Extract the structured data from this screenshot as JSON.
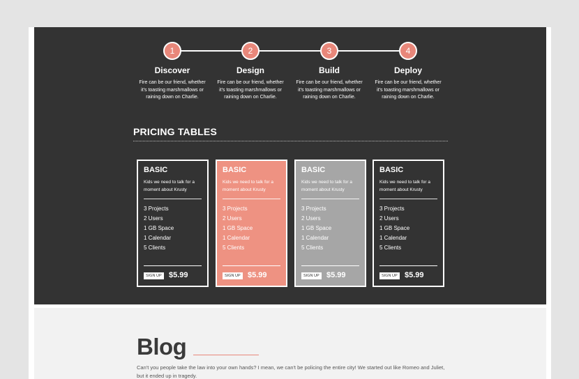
{
  "process": {
    "steps": [
      {
        "number": "1",
        "title": "Discover",
        "desc": "Fire can be our friend, whether it's toasting marshmallows or raining down on Charlie."
      },
      {
        "number": "2",
        "title": "Design",
        "desc": "Fire can be our friend, whether it's toasting marshmallows or raining down on Charlie."
      },
      {
        "number": "3",
        "title": "Build",
        "desc": "Fire can be our friend, whether it's toasting marshmallows or raining down on Charlie."
      },
      {
        "number": "4",
        "title": "Deploy",
        "desc": "Fire can be our friend, whether it's toasting marshmallows or raining down on Charlie."
      }
    ]
  },
  "pricing": {
    "heading": "PRICING TABLES",
    "cards": [
      {
        "title": "BASIC",
        "desc": "Kids we need to talk for a moment about Krusty",
        "features": [
          "3 Projects",
          "2 Users",
          "1 GB Space",
          "1 Calendar",
          "5 Clients"
        ],
        "signup_label": "SIGN UP",
        "price": "$5.99",
        "bg": "#333333"
      },
      {
        "title": "BASIC",
        "desc": "Kids we need to talk for a moment about Krusty",
        "features": [
          "3 Projects",
          "2 Users",
          "1 GB Space",
          "1 Calendar",
          "5 Clients"
        ],
        "signup_label": "SIGN UP",
        "price": "$5.99",
        "bg": "#ee9282"
      },
      {
        "title": "BASIC",
        "desc": "Kids we need to talk for a moment about Krusty",
        "features": [
          "3 Projects",
          "2 Users",
          "1 GB Space",
          "1 Calendar",
          "5 Clients"
        ],
        "signup_label": "SIGN UP",
        "price": "$5.99",
        "bg": "#a6a6a6"
      },
      {
        "title": "BASIC",
        "desc": "Kids we need to talk for a moment about Krusty",
        "features": [
          "3 Projects",
          "2 Users",
          "1 GB Space",
          "1 Calendar",
          "5 Clients"
        ],
        "signup_label": "SIGN UP",
        "price": "$5.99",
        "bg": "#333333"
      }
    ]
  },
  "blog": {
    "title": "Blog",
    "text": "Can't you people take the law into your own hands? I mean, we can't be policing the entire city! We started out like Romeo and Juliet, but it ended up in tragedy."
  },
  "colors": {
    "accent": "#e8877a",
    "dark_bg": "#333333",
    "light_bg": "#f2f2f2"
  }
}
